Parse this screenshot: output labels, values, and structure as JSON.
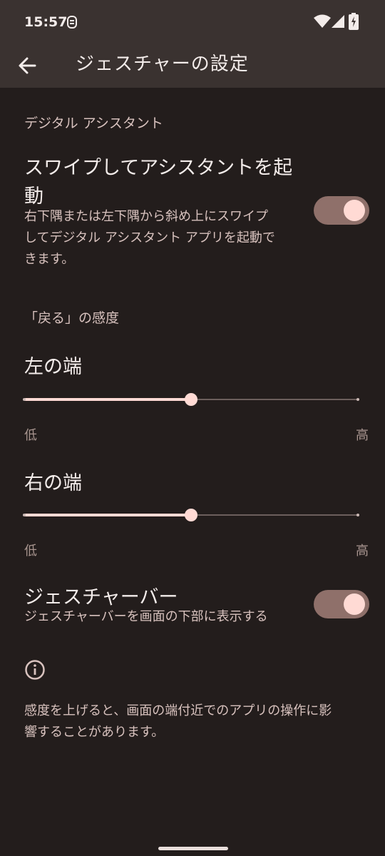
{
  "status_bar": {
    "time": "15:57",
    "icons": [
      "notification-icon",
      "wifi-icon",
      "signal-icon",
      "battery-charging-icon"
    ]
  },
  "app_bar": {
    "back_icon": "arrow-back-icon",
    "title": "ジェスチャーの設定"
  },
  "assistant_section": {
    "header": "デジタル アシスタント",
    "swipe_assistant": {
      "title_line1": "スワイプしてアシスタントを起",
      "title_line2": "動",
      "summary_line1": "右下隅または左下隅から斜め上にスワイプ",
      "summary_line2": "してデジタル アシスタント アプリを起動で",
      "summary_line3": "きます。",
      "enabled": true
    }
  },
  "back_sensitivity_section": {
    "header": "「戻る」の感度",
    "left_edge": {
      "title": "左の端",
      "low_label": "低",
      "high_label": "高",
      "value_fraction": 0.5
    },
    "right_edge": {
      "title": "右の端",
      "low_label": "低",
      "high_label": "高",
      "value_fraction": 0.5
    }
  },
  "gesture_bar": {
    "title": "ジェスチャーバー",
    "summary": "ジェスチャーバーを画面の下部に表示する",
    "enabled": true
  },
  "footer": {
    "info_icon": "info-icon",
    "text_line1": "感度を上げると、画面の端付近でのアプリの操作に影",
    "text_line2": "響することがあります。"
  },
  "colors": {
    "background": "#231d1c",
    "app_bar": "#3a3230",
    "switch_track": "#8f706a",
    "accent": "#ffdad4"
  }
}
